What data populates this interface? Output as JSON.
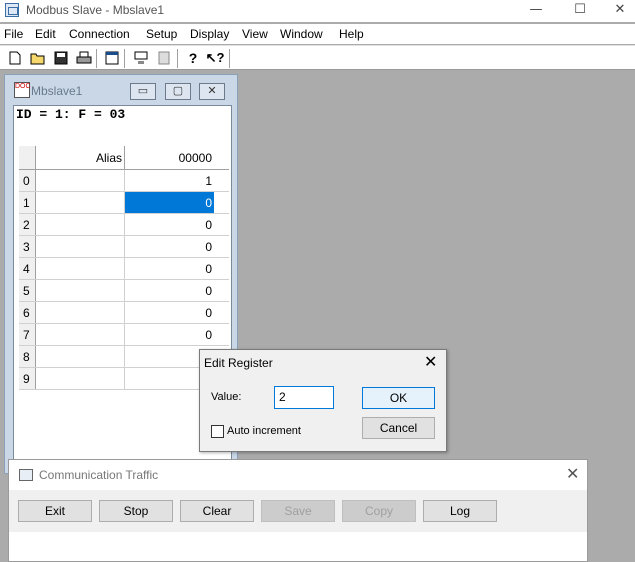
{
  "window": {
    "title": "Modbus Slave - Mbslave1",
    "minimize": "—",
    "maximize": "☐",
    "close": "✕"
  },
  "menu": [
    "File",
    "Edit",
    "Connection",
    "Setup",
    "Display",
    "View",
    "Window",
    "Help"
  ],
  "toolbar": {
    "icons": [
      "new-icon",
      "open-icon",
      "save-icon",
      "print-icon",
      "window-icon",
      "connect-icon",
      "disconnect-icon",
      "help-icon",
      "context-help-icon"
    ]
  },
  "child": {
    "title": "Mbslave1",
    "icon_text": "DOC",
    "min": "▭",
    "max": "▢",
    "close": "✕",
    "id_line": "ID = 1: F = 03",
    "grid": {
      "headers": {
        "alias": "Alias",
        "value": "00000"
      },
      "rows": [
        {
          "n": "0",
          "v": "1"
        },
        {
          "n": "1",
          "v": "0"
        },
        {
          "n": "2",
          "v": "0"
        },
        {
          "n": "3",
          "v": "0"
        },
        {
          "n": "4",
          "v": "0"
        },
        {
          "n": "5",
          "v": "0"
        },
        {
          "n": "6",
          "v": "0"
        },
        {
          "n": "7",
          "v": "0"
        },
        {
          "n": "8",
          "v": ""
        },
        {
          "n": "9",
          "v": ""
        }
      ]
    }
  },
  "dialog": {
    "title": "Edit Register",
    "close": "✕",
    "value_label": "Value:",
    "value": "2",
    "ok": "OK",
    "cancel": "Cancel",
    "auto_increment": "Auto increment"
  },
  "traffic": {
    "title": "Communication Traffic",
    "close": "✕",
    "buttons": [
      "Exit",
      "Stop",
      "Clear",
      "Save",
      "Copy",
      "Log"
    ]
  },
  "colors": {
    "selection": "#0078d7",
    "desktop": "#ababab"
  }
}
